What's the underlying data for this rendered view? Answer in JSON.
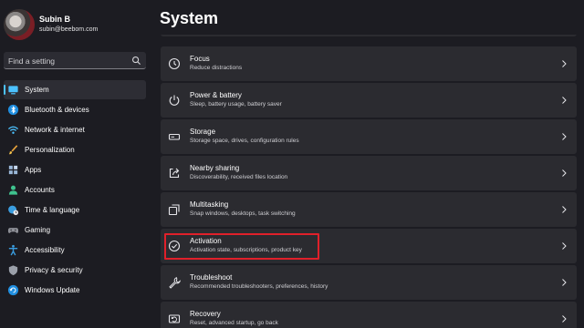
{
  "profile": {
    "name": "Subin B",
    "email": "subin@beebom.com"
  },
  "search": {
    "placeholder": "Find a setting"
  },
  "sidebar": {
    "items": [
      {
        "label": "System",
        "icon": "monitor-icon",
        "active": true
      },
      {
        "label": "Bluetooth & devices",
        "icon": "bluetooth-icon"
      },
      {
        "label": "Network & internet",
        "icon": "wifi-icon"
      },
      {
        "label": "Personalization",
        "icon": "brush-icon"
      },
      {
        "label": "Apps",
        "icon": "apps-icon"
      },
      {
        "label": "Accounts",
        "icon": "person-icon"
      },
      {
        "label": "Time & language",
        "icon": "globe-clock-icon"
      },
      {
        "label": "Gaming",
        "icon": "gamepad-icon"
      },
      {
        "label": "Accessibility",
        "icon": "accessibility-icon"
      },
      {
        "label": "Privacy & security",
        "icon": "shield-icon"
      },
      {
        "label": "Windows Update",
        "icon": "update-icon"
      }
    ]
  },
  "page": {
    "title": "System"
  },
  "cards": [
    {
      "title": "Focus",
      "subtitle": "Reduce distractions",
      "icon": "focus-icon"
    },
    {
      "title": "Power & battery",
      "subtitle": "Sleep, battery usage, battery saver",
      "icon": "power-icon"
    },
    {
      "title": "Storage",
      "subtitle": "Storage space, drives, configuration rules",
      "icon": "storage-icon"
    },
    {
      "title": "Nearby sharing",
      "subtitle": "Discoverability, received files location",
      "icon": "share-icon"
    },
    {
      "title": "Multitasking",
      "subtitle": "Snap windows, desktops, task switching",
      "icon": "multitasking-icon"
    },
    {
      "title": "Activation",
      "subtitle": "Activation state, subscriptions, product key",
      "icon": "check-circle-icon",
      "highlighted": true
    },
    {
      "title": "Troubleshoot",
      "subtitle": "Recommended troubleshooters, preferences, history",
      "icon": "wrench-icon"
    },
    {
      "title": "Recovery",
      "subtitle": "Reset, advanced startup, go back",
      "icon": "recovery-icon"
    }
  ],
  "colors": {
    "accent": "#4cc2ff",
    "highlight": "#e0202a",
    "background": "#1c1c22",
    "card": "#2b2b30"
  }
}
